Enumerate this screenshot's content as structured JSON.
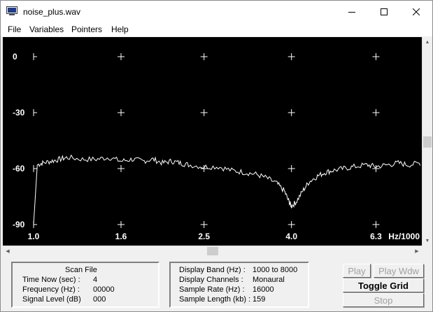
{
  "window": {
    "title": "noise_plus.wav"
  },
  "menu": [
    "File",
    "Variables",
    "Pointers",
    "Help"
  ],
  "chart_data": {
    "type": "line",
    "y_tick_labels": [
      "0",
      "-30",
      "-60",
      "-90"
    ],
    "y_ticks": [
      0,
      -30,
      -60,
      -90
    ],
    "x_tick_labels": [
      "1.0",
      "1.6",
      "2.5",
      "4.0",
      "6.3"
    ],
    "x_ticks": [
      1.0,
      1.6,
      2.5,
      4.0,
      6.3
    ],
    "xlabel": "Hz/1000",
    "x_scale": "log",
    "xlim": [
      1.0,
      8.0
    ],
    "ylim": [
      -90,
      0
    ],
    "grid": "crosshair markers",
    "line_color": "#ffffff",
    "background": "#000000",
    "series": [
      {
        "x": [
          1.0,
          1.02,
          1.05,
          1.1,
          1.15,
          1.2,
          1.3,
          1.4,
          1.5,
          1.6,
          1.7,
          1.8,
          1.9,
          2.0,
          2.1,
          2.2,
          2.3,
          2.5,
          2.7,
          2.9,
          3.1,
          3.3,
          3.5,
          3.7,
          3.85,
          3.95,
          4.0,
          4.1,
          4.25,
          4.4,
          4.6,
          4.8,
          5.0,
          5.3,
          5.6,
          6.0,
          6.3,
          6.7,
          7.1,
          7.5,
          8.0
        ],
        "y": [
          -90,
          -58,
          -57,
          -56,
          -55,
          -54,
          -55,
          -55,
          -54,
          -56,
          -55,
          -56,
          -55,
          -57,
          -56,
          -57,
          -58,
          -59,
          -59,
          -61,
          -62,
          -63,
          -65,
          -68,
          -72,
          -78,
          -80,
          -78,
          -72,
          -67,
          -64,
          -62,
          -61,
          -60,
          -59,
          -58,
          -59,
          -58,
          -57,
          -58,
          -57
        ]
      }
    ]
  },
  "status_left": {
    "heading": "Scan File",
    "rows": [
      {
        "label": "Time Now (sec) :",
        "value": "4"
      },
      {
        "label": "Frequency (Hz) :",
        "value": "00000"
      },
      {
        "label": "Signal Level (dB)",
        "value": "000"
      }
    ]
  },
  "status_mid": {
    "rows": [
      {
        "label": "Display Band (Hz) :",
        "value": "1000 to 8000"
      },
      {
        "label": "Display Channels :",
        "value": "Monaural"
      },
      {
        "label": "Sample Rate (Hz) :",
        "value": "16000"
      },
      {
        "label": "Sample Length (kb) :",
        "value": "159"
      }
    ]
  },
  "buttons": {
    "play": "Play",
    "play_wdw": "Play Wdw",
    "toggle_grid": "Toggle Grid",
    "stop": "Stop"
  }
}
